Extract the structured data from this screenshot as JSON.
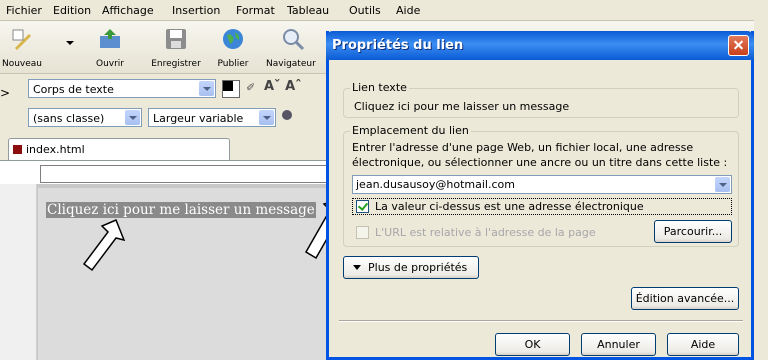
{
  "menubar": {
    "items": [
      "Fichier",
      "Edition",
      "Affichage",
      "Insertion",
      "Format",
      "Tableau",
      "Outils",
      "Aide"
    ]
  },
  "toolbar": {
    "buttons": [
      {
        "label": "Nouveau",
        "icon": "new-page-icon"
      },
      {
        "label": "Ouvrir",
        "icon": "open-folder-icon"
      },
      {
        "label": "Enregistrer",
        "icon": "save-disk-icon"
      },
      {
        "label": "Publier",
        "icon": "globe-publish-icon"
      },
      {
        "label": "Navigateur",
        "icon": "magnifier-icon"
      }
    ]
  },
  "format": {
    "paragraph_style": "Corps de texte",
    "css_class": "(sans classe)",
    "font_width": "Largeur variable",
    "font_size_icons": "Aˇ Aˆ"
  },
  "document": {
    "tab_title": "index.html",
    "link_text": "Cliquez ici pour me laisser un message"
  },
  "dialog": {
    "title": "Propriétés du lien",
    "link_text_group": {
      "legend": "Lien texte",
      "value": "Cliquez ici pour me laisser un message"
    },
    "location_group": {
      "legend": "Emplacement du lien",
      "instruction_line1": "Entrer l'adresse d'une page Web, un fichier local, une adresse",
      "instruction_line2": "électronique, ou sélectionner une ancre ou un titre dans cette liste :",
      "url_value": "jean.dusausoy@hotmail.com",
      "email_checkbox_label": "La valeur ci-dessus est une adresse électronique",
      "email_checkbox_checked": true,
      "relative_checkbox_label": "L'URL est relative à l'adresse de la page",
      "relative_checkbox_checked": false,
      "browse_label": "Parcourir..."
    },
    "more_properties_label": "Plus de propriétés",
    "advanced_edit_label": "Édition avancée...",
    "ok_label": "OK",
    "cancel_label": "Annuler",
    "help_label": "Aide"
  },
  "colors": {
    "titlebar": "#0a5ad4",
    "check_green": "#21a121",
    "disabled_text": "#a7a6aa"
  }
}
